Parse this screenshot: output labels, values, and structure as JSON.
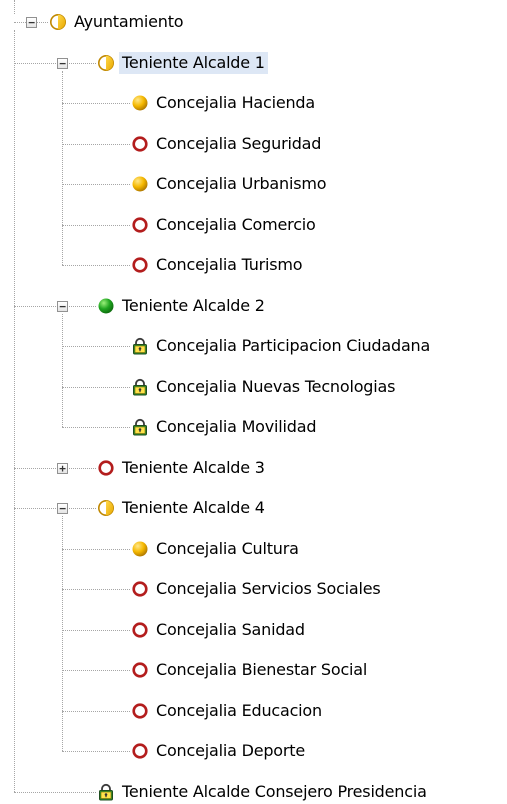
{
  "tree": {
    "nodes": [
      {
        "label": "Ayuntamiento",
        "status": "half",
        "depth": 0,
        "expander": "minus",
        "selected": false
      },
      {
        "label": "Teniente Alcalde 1",
        "status": "half",
        "depth": 1,
        "expander": "minus",
        "selected": true
      },
      {
        "label": "Concejalia Hacienda",
        "status": "yellow",
        "depth": 2,
        "expander": "",
        "selected": false
      },
      {
        "label": "Concejalia Seguridad",
        "status": "red-ring",
        "depth": 2,
        "expander": "",
        "selected": false
      },
      {
        "label": "Concejalia Urbanismo",
        "status": "yellow",
        "depth": 2,
        "expander": "",
        "selected": false
      },
      {
        "label": "Concejalia Comercio",
        "status": "red-ring",
        "depth": 2,
        "expander": "",
        "selected": false
      },
      {
        "label": "Concejalia Turismo",
        "status": "red-ring",
        "depth": 2,
        "expander": "",
        "selected": false
      },
      {
        "label": "Teniente Alcalde 2",
        "status": "green",
        "depth": 1,
        "expander": "minus",
        "selected": false
      },
      {
        "label": "Concejalia Participacion Ciudadana",
        "status": "lock",
        "depth": 2,
        "expander": "",
        "selected": false
      },
      {
        "label": "Concejalia Nuevas Tecnologias",
        "status": "lock",
        "depth": 2,
        "expander": "",
        "selected": false
      },
      {
        "label": "Concejalia Movilidad",
        "status": "lock",
        "depth": 2,
        "expander": "",
        "selected": false
      },
      {
        "label": "Teniente Alcalde 3",
        "status": "red-ring",
        "depth": 1,
        "expander": "plus",
        "selected": false
      },
      {
        "label": "Teniente Alcalde 4",
        "status": "half",
        "depth": 1,
        "expander": "minus",
        "selected": false
      },
      {
        "label": "Concejalia Cultura",
        "status": "yellow",
        "depth": 2,
        "expander": "",
        "selected": false
      },
      {
        "label": "Concejalia Servicios Sociales",
        "status": "red-ring",
        "depth": 2,
        "expander": "",
        "selected": false
      },
      {
        "label": "Concejalia Sanidad",
        "status": "red-ring",
        "depth": 2,
        "expander": "",
        "selected": false
      },
      {
        "label": "Concejalia Bienestar Social",
        "status": "red-ring",
        "depth": 2,
        "expander": "",
        "selected": false
      },
      {
        "label": "Concejalia Educacion",
        "status": "red-ring",
        "depth": 2,
        "expander": "",
        "selected": false
      },
      {
        "label": "Concejalia Deporte",
        "status": "red-ring",
        "depth": 2,
        "expander": "",
        "selected": false
      },
      {
        "label": "Teniente Alcalde Consejero Presidencia",
        "status": "lock",
        "depth": 1,
        "expander": "",
        "selected": false
      }
    ]
  },
  "colors": {
    "selection": "#dde7f5",
    "yellow": "#e8a800",
    "red": "#b31d1d",
    "green": "#1fa51f"
  }
}
